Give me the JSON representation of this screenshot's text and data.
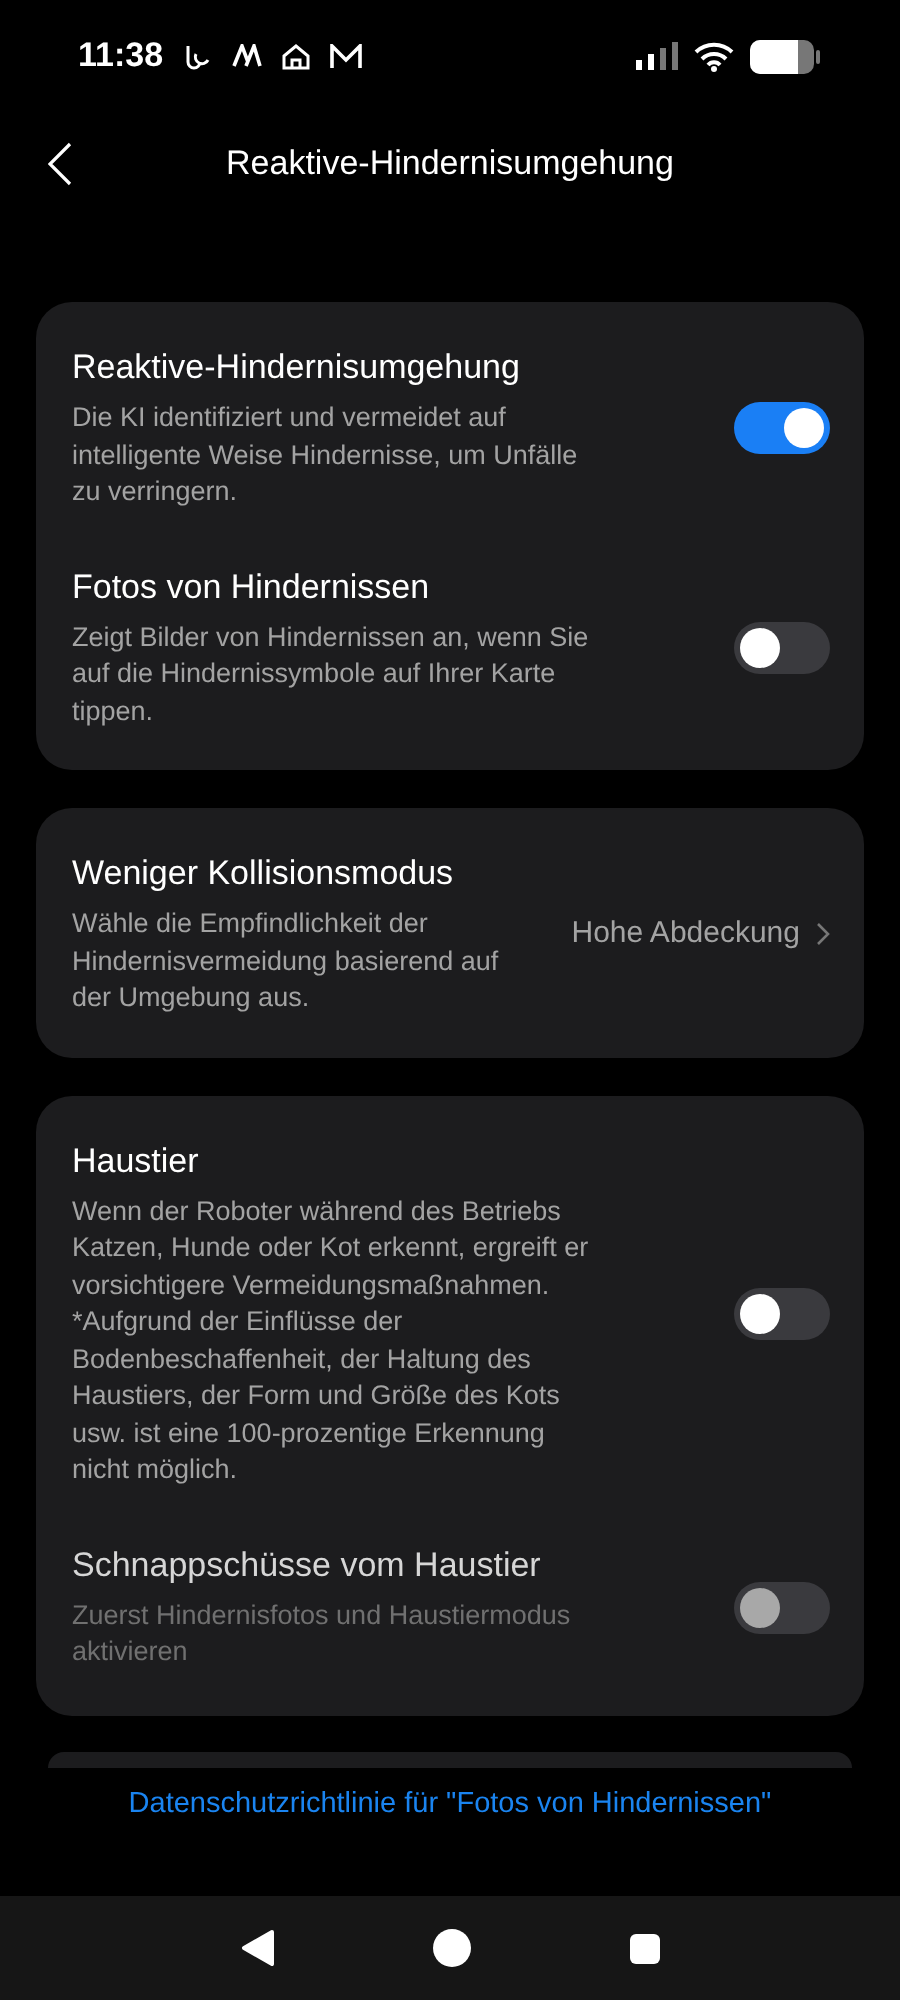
{
  "status_bar": {
    "time": "11:38"
  },
  "header": {
    "title": "Reaktive-Hindernisumgehung"
  },
  "cards": [
    {
      "rows": [
        {
          "kind": "toggle",
          "title": "Reaktive-Hindernisumgehung",
          "description": "Die KI identifiziert und vermeidet auf intelligente Weise Hindernisse, um Unfälle zu verringern.",
          "on": true,
          "disabled": false
        },
        {
          "kind": "toggle",
          "title": "Fotos von Hindernissen",
          "description": "Zeigt Bilder von Hindernissen an, wenn Sie auf die Hindernissymbole auf Ihrer Karte tippen.",
          "on": false,
          "disabled": false
        }
      ]
    },
    {
      "rows": [
        {
          "kind": "value",
          "title": "Weniger Kollisionsmodus",
          "description": "Wähle die Empfindlichkeit der Hindernisvermeidung basierend auf der Umgebung aus.",
          "value": "Hohe Abdeckung"
        }
      ]
    },
    {
      "rows": [
        {
          "kind": "toggle",
          "title": "Haustier",
          "description": "Wenn der Roboter während des Betriebs Katzen, Hunde oder Kot erkennt, ergreift er vorsichtigere Vermeidungsmaßnahmen. *Aufgrund der Einflüsse der Bodenbeschaffenheit, der Haltung des Haustiers, der Form und Größe des Kots usw. ist eine 100-prozentige Erkennung nicht möglich.",
          "on": false,
          "disabled": false
        },
        {
          "kind": "toggle",
          "title": "Schnappschüsse vom Haustier",
          "description": "Zuerst Hindernisfotos und Haustiermodus aktivieren",
          "on": false,
          "disabled": true
        }
      ]
    }
  ],
  "link": "Datenschutzrichtlinie für \"Fotos von Hindernissen\""
}
